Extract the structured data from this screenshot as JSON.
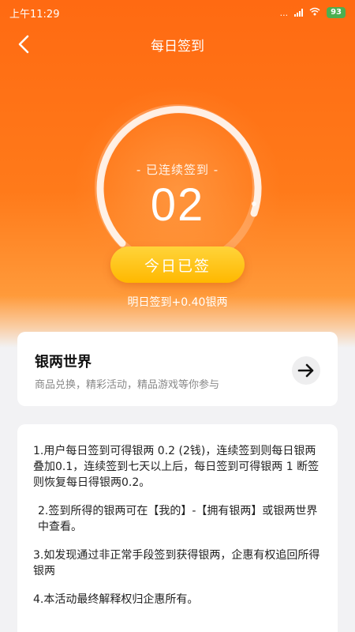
{
  "status_bar": {
    "time": "上午11:29",
    "network": "...",
    "battery": "93"
  },
  "header": {
    "title": "每日签到"
  },
  "checkin": {
    "streak_label": "- 已连续签到 -",
    "streak_days": "02",
    "checked_button": "今日已签",
    "tomorrow_reward": "明日签到+0.40银两"
  },
  "world_card": {
    "title": "银两世界",
    "subtitle": "商品兑换，精彩活动，精品游戏等你参与"
  },
  "rules": [
    "1.用户每日签到可得银两 0.2 (2钱)，连续签到则每日银两叠加0.1，连续签到七天以上后，每日签到可得银两 1 断签则恢复每日得银两0.2。",
    " 2.签到所得的银两可在【我的】-【拥有银两】或银两世界中查看。",
    "3.如发现通过非正常手段签到获得银两，企惠有权追回所得银两",
    "4.本活动最终解释权归企惠所有。"
  ],
  "colors": {
    "accent": "#ff6a12",
    "button": "#ffb800",
    "battery": "#4caf50"
  },
  "icons": {
    "back": "back-arrow-icon",
    "go": "arrow-right-icon",
    "wifi": "wifi-icon",
    "signal": "signal-icon"
  }
}
